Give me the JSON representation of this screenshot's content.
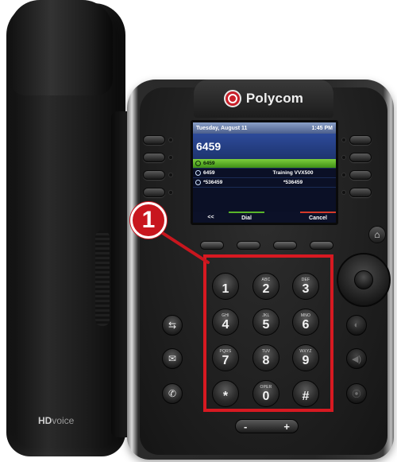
{
  "brand": {
    "name": "Polycom",
    "accent": "#c8202a"
  },
  "handset_label": {
    "hd": "HD",
    "voice": "voice"
  },
  "screen": {
    "status_date": "Tuesday, August 11",
    "status_time": "1:45 PM",
    "entry_number": "6459",
    "rows": [
      {
        "number": "6459",
        "name": "",
        "selected": true
      },
      {
        "number": "6459",
        "name": "Training VVX500",
        "selected": false
      },
      {
        "number": "*536459",
        "name": "*536459",
        "selected": false
      }
    ],
    "softkeys": {
      "back": "<<",
      "dial": "Dial",
      "cancel": "Cancel"
    }
  },
  "keypad": {
    "keys": [
      {
        "digit": "1",
        "letters": ""
      },
      {
        "digit": "2",
        "letters": "ABC"
      },
      {
        "digit": "3",
        "letters": "DEF"
      },
      {
        "digit": "4",
        "letters": "GHI"
      },
      {
        "digit": "5",
        "letters": "JKL"
      },
      {
        "digit": "6",
        "letters": "MNO"
      },
      {
        "digit": "7",
        "letters": "PQRS"
      },
      {
        "digit": "8",
        "letters": "TUV"
      },
      {
        "digit": "9",
        "letters": "WXYZ"
      },
      {
        "digit": "*",
        "letters": ""
      },
      {
        "digit": "0",
        "letters": "OPER"
      },
      {
        "digit": "#",
        "letters": ""
      }
    ],
    "highlight_color": "#d71921"
  },
  "volume": {
    "minus": "-",
    "plus": "+"
  },
  "callout": {
    "label": "1",
    "color": "#c8161e"
  },
  "icons": {
    "home": "home-icon",
    "transfer": "transfer-icon",
    "messages": "envelope-icon",
    "call": "phone-icon",
    "headset": "headset-icon",
    "speaker": "speaker-icon",
    "mute": "microphone-icon"
  }
}
